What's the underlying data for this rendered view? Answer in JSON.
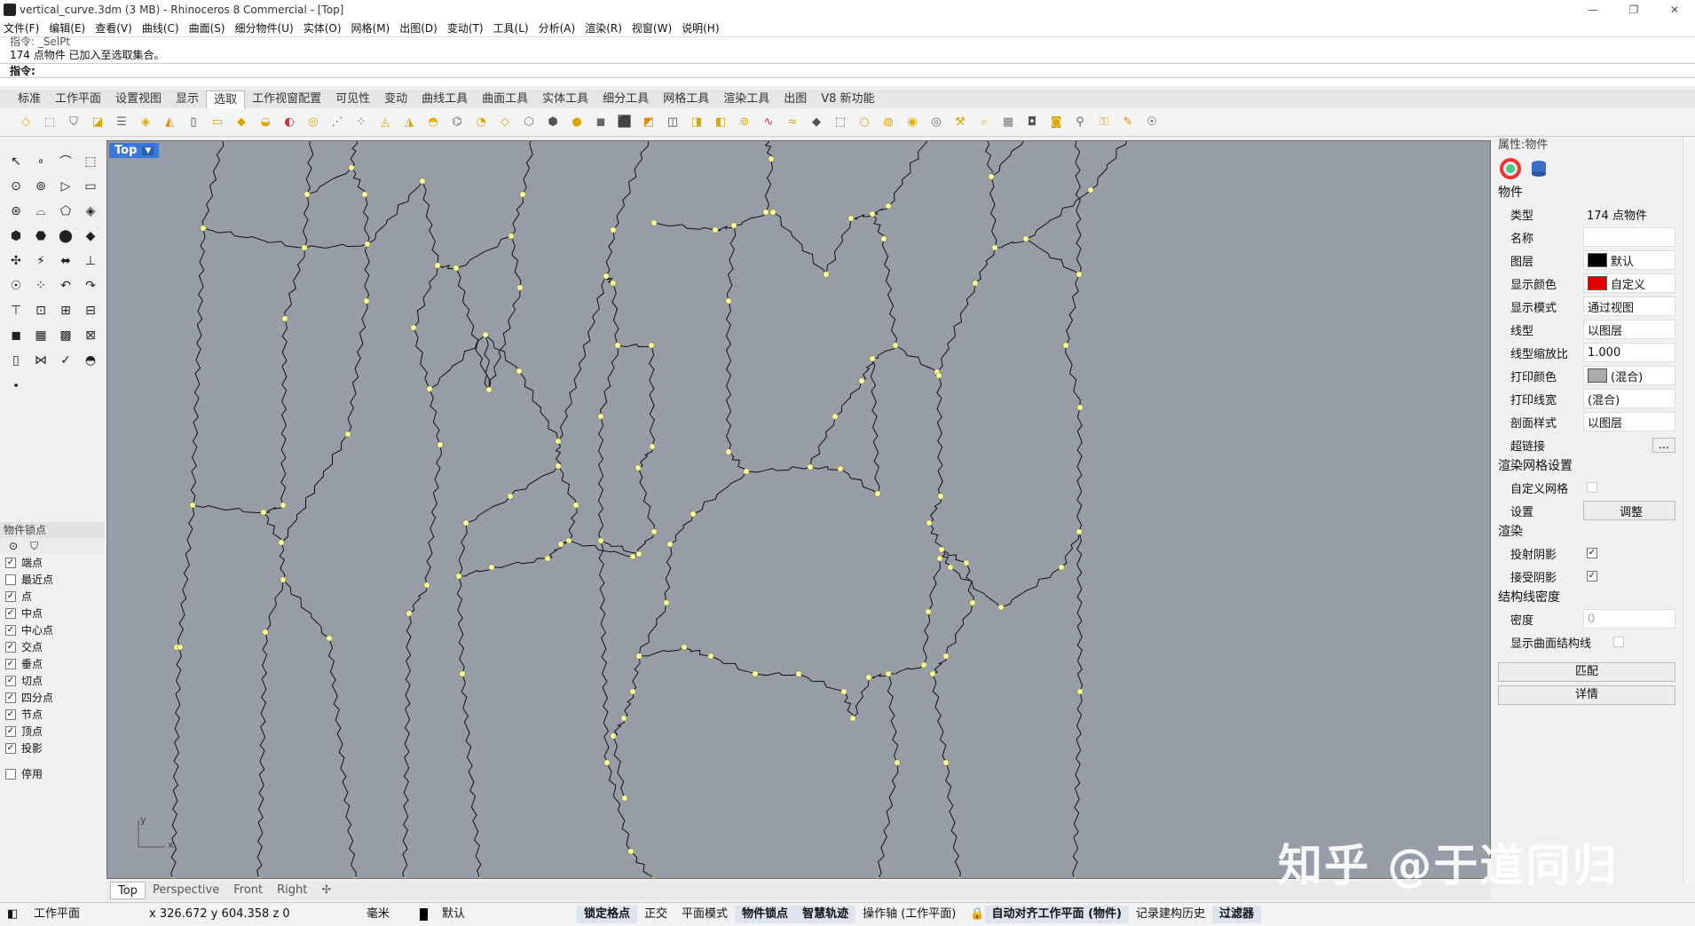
{
  "title": "vertical_curve.3dm (3 MB) - Rhinoceros 8 Commercial - [Top]",
  "menu": [
    "文件(F)",
    "编辑(E)",
    "查看(V)",
    "曲线(C)",
    "曲面(S)",
    "细分物件(U)",
    "实体(O)",
    "网格(M)",
    "出图(D)",
    "变动(T)",
    "工具(L)",
    "分析(A)",
    "渲染(R)",
    "视窗(W)",
    "说明(H)"
  ],
  "command": {
    "history1": "指令: _SelPt",
    "history2": "174 点物件 已加入至选取集合。",
    "prompt": "指令:"
  },
  "tabs": [
    "标准",
    "工作平面",
    "设置视图",
    "显示",
    "选取",
    "工作视窗配置",
    "可见性",
    "变动",
    "曲线工具",
    "曲面工具",
    "实体工具",
    "细分工具",
    "网格工具",
    "渲染工具",
    "出图",
    "V8 新功能"
  ],
  "active_tab": "选取",
  "viewport": {
    "label": "Top",
    "axis_x": "x",
    "axis_y": "y"
  },
  "view_tabs": [
    "Top",
    "Perspective",
    "Front",
    "Right"
  ],
  "osnap": {
    "header": "物件锁点",
    "items": [
      {
        "label": "端点",
        "checked": true
      },
      {
        "label": "最近点",
        "checked": false
      },
      {
        "label": "点",
        "checked": true
      },
      {
        "label": "中点",
        "checked": true
      },
      {
        "label": "中心点",
        "checked": true
      },
      {
        "label": "交点",
        "checked": true
      },
      {
        "label": "垂点",
        "checked": true
      },
      {
        "label": "切点",
        "checked": true
      },
      {
        "label": "四分点",
        "checked": true
      },
      {
        "label": "节点",
        "checked": true
      },
      {
        "label": "顶点",
        "checked": true
      },
      {
        "label": "投影",
        "checked": true
      }
    ],
    "disable": "停用"
  },
  "properties": {
    "header": "属性:物件",
    "section_object": "物件",
    "type_label": "类型",
    "type_value": "174 点物件",
    "name_label": "名称",
    "name_value": "",
    "layer_label": "图层",
    "layer_value": "默认",
    "display_color_label": "显示颜色",
    "display_color_value": "自定义",
    "display_mode_label": "显示模式",
    "display_mode_value": "通过视图",
    "linetype_label": "线型",
    "linetype_value": "以图层",
    "linetype_scale_label": "线型缩放比",
    "linetype_scale_value": "1.000",
    "print_color_label": "打印颜色",
    "print_color_value": "(混合)",
    "print_width_label": "打印线宽",
    "print_width_value": "(混合)",
    "section_style_label": "剖面样式",
    "section_style_value": "以图层",
    "hyperlink_label": "超链接",
    "hyperlink_btn": "...",
    "section_render_mesh": "渲染网格设置",
    "custom_mesh_label": "自定义网格",
    "settings_label": "设置",
    "adjust_btn": "调整",
    "section_render": "渲染",
    "cast_shadow_label": "投射阴影",
    "receive_shadow_label": "接受阴影",
    "section_isocurve": "结构线密度",
    "density_label": "密度",
    "density_value": "0",
    "show_surface_iso_label": "显示曲面结构线",
    "match_btn": "匹配",
    "details_btn": "详情"
  },
  "status": {
    "cplane": "工作平面",
    "coords": "x 326.672  y 604.358  z 0",
    "units": "毫米",
    "layer": "默认",
    "grid_snap": "锁定格点",
    "ortho": "正交",
    "planar": "平面模式",
    "osnap": "物件锁点",
    "smarttrack": "智慧轨迹",
    "gumball": "操作轴 (工作平面)",
    "auto_cplane": "自动对齐工作平面 (物件)",
    "history": "记录建构历史",
    "filter": "过滤器"
  },
  "watermark": "知乎 @于道同归",
  "colors": {
    "viewport_bg": "#979da6",
    "point": "#ffff99",
    "accent": "#3b78d8",
    "display_color": "#e00000"
  }
}
